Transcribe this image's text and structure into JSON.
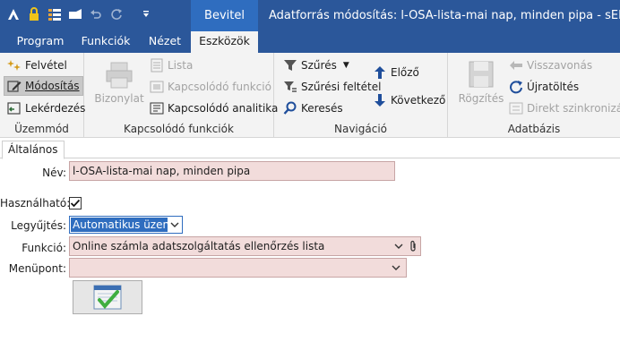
{
  "titlebar": {
    "context_tab": "Bevitel",
    "title": "Adatforrás módosítás: l-OSA-lista-mai nap, minden pipa - sERPa -"
  },
  "tabs": [
    {
      "label": "Program"
    },
    {
      "label": "Funkciók"
    },
    {
      "label": "Nézet"
    },
    {
      "label": "Eszközök"
    }
  ],
  "ribbon": {
    "mode": {
      "items": [
        "Felvétel",
        "Módosítás",
        "Lekérdezés"
      ],
      "label": "Üzemmód"
    },
    "related": {
      "big_label": "Bizonylat",
      "items": [
        "Lista",
        "Kapcsolódó funkció",
        "Kapcsolódó analitika"
      ],
      "label": "Kapcsolódó funkciók"
    },
    "navigation": {
      "filter": "Szűrés",
      "filter_condition": "Szűrési feltétel",
      "search": "Keresés",
      "prev": "Előző",
      "next": "Következő",
      "label": "Navigáció"
    },
    "database": {
      "save": "Rögzítés",
      "undo": "Visszavonás",
      "reload": "Újratöltés",
      "sync": "Direkt szinkronizálás",
      "label": "Adatbázis"
    }
  },
  "form_tab": "Általános",
  "form": {
    "name_label": "Név:",
    "name_value": "l-OSA-lista-mai nap, minden pipa",
    "usable_label": "Használható:",
    "usable_checked": true,
    "collect_label": "Legyűjtés:",
    "collect_value": "Automatikus üzenet",
    "function_label": "Funkció:",
    "function_value": "Online számla adatszolgáltatás ellenőrzés lista",
    "menu_label": "Menüpont:",
    "menu_value": ""
  }
}
